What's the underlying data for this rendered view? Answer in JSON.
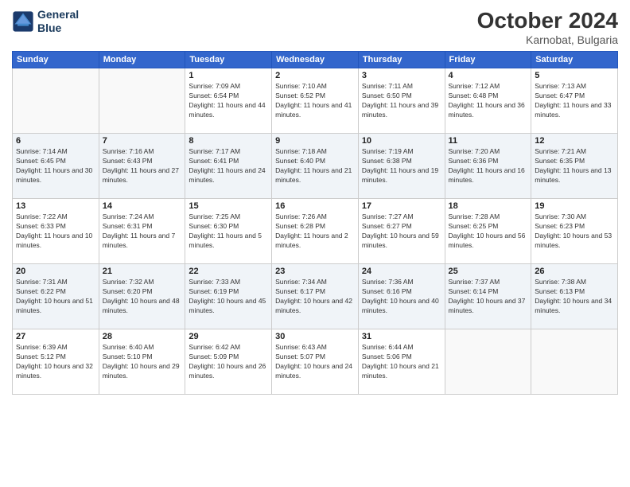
{
  "header": {
    "logo_line1": "General",
    "logo_line2": "Blue",
    "month": "October 2024",
    "location": "Karnobat, Bulgaria"
  },
  "weekdays": [
    "Sunday",
    "Monday",
    "Tuesday",
    "Wednesday",
    "Thursday",
    "Friday",
    "Saturday"
  ],
  "weeks": [
    [
      {
        "day": "",
        "info": ""
      },
      {
        "day": "",
        "info": ""
      },
      {
        "day": "1",
        "info": "Sunrise: 7:09 AM\nSunset: 6:54 PM\nDaylight: 11 hours and 44 minutes."
      },
      {
        "day": "2",
        "info": "Sunrise: 7:10 AM\nSunset: 6:52 PM\nDaylight: 11 hours and 41 minutes."
      },
      {
        "day": "3",
        "info": "Sunrise: 7:11 AM\nSunset: 6:50 PM\nDaylight: 11 hours and 39 minutes."
      },
      {
        "day": "4",
        "info": "Sunrise: 7:12 AM\nSunset: 6:48 PM\nDaylight: 11 hours and 36 minutes."
      },
      {
        "day": "5",
        "info": "Sunrise: 7:13 AM\nSunset: 6:47 PM\nDaylight: 11 hours and 33 minutes."
      }
    ],
    [
      {
        "day": "6",
        "info": "Sunrise: 7:14 AM\nSunset: 6:45 PM\nDaylight: 11 hours and 30 minutes."
      },
      {
        "day": "7",
        "info": "Sunrise: 7:16 AM\nSunset: 6:43 PM\nDaylight: 11 hours and 27 minutes."
      },
      {
        "day": "8",
        "info": "Sunrise: 7:17 AM\nSunset: 6:41 PM\nDaylight: 11 hours and 24 minutes."
      },
      {
        "day": "9",
        "info": "Sunrise: 7:18 AM\nSunset: 6:40 PM\nDaylight: 11 hours and 21 minutes."
      },
      {
        "day": "10",
        "info": "Sunrise: 7:19 AM\nSunset: 6:38 PM\nDaylight: 11 hours and 19 minutes."
      },
      {
        "day": "11",
        "info": "Sunrise: 7:20 AM\nSunset: 6:36 PM\nDaylight: 11 hours and 16 minutes."
      },
      {
        "day": "12",
        "info": "Sunrise: 7:21 AM\nSunset: 6:35 PM\nDaylight: 11 hours and 13 minutes."
      }
    ],
    [
      {
        "day": "13",
        "info": "Sunrise: 7:22 AM\nSunset: 6:33 PM\nDaylight: 11 hours and 10 minutes."
      },
      {
        "day": "14",
        "info": "Sunrise: 7:24 AM\nSunset: 6:31 PM\nDaylight: 11 hours and 7 minutes."
      },
      {
        "day": "15",
        "info": "Sunrise: 7:25 AM\nSunset: 6:30 PM\nDaylight: 11 hours and 5 minutes."
      },
      {
        "day": "16",
        "info": "Sunrise: 7:26 AM\nSunset: 6:28 PM\nDaylight: 11 hours and 2 minutes."
      },
      {
        "day": "17",
        "info": "Sunrise: 7:27 AM\nSunset: 6:27 PM\nDaylight: 10 hours and 59 minutes."
      },
      {
        "day": "18",
        "info": "Sunrise: 7:28 AM\nSunset: 6:25 PM\nDaylight: 10 hours and 56 minutes."
      },
      {
        "day": "19",
        "info": "Sunrise: 7:30 AM\nSunset: 6:23 PM\nDaylight: 10 hours and 53 minutes."
      }
    ],
    [
      {
        "day": "20",
        "info": "Sunrise: 7:31 AM\nSunset: 6:22 PM\nDaylight: 10 hours and 51 minutes."
      },
      {
        "day": "21",
        "info": "Sunrise: 7:32 AM\nSunset: 6:20 PM\nDaylight: 10 hours and 48 minutes."
      },
      {
        "day": "22",
        "info": "Sunrise: 7:33 AM\nSunset: 6:19 PM\nDaylight: 10 hours and 45 minutes."
      },
      {
        "day": "23",
        "info": "Sunrise: 7:34 AM\nSunset: 6:17 PM\nDaylight: 10 hours and 42 minutes."
      },
      {
        "day": "24",
        "info": "Sunrise: 7:36 AM\nSunset: 6:16 PM\nDaylight: 10 hours and 40 minutes."
      },
      {
        "day": "25",
        "info": "Sunrise: 7:37 AM\nSunset: 6:14 PM\nDaylight: 10 hours and 37 minutes."
      },
      {
        "day": "26",
        "info": "Sunrise: 7:38 AM\nSunset: 6:13 PM\nDaylight: 10 hours and 34 minutes."
      }
    ],
    [
      {
        "day": "27",
        "info": "Sunrise: 6:39 AM\nSunset: 5:12 PM\nDaylight: 10 hours and 32 minutes."
      },
      {
        "day": "28",
        "info": "Sunrise: 6:40 AM\nSunset: 5:10 PM\nDaylight: 10 hours and 29 minutes."
      },
      {
        "day": "29",
        "info": "Sunrise: 6:42 AM\nSunset: 5:09 PM\nDaylight: 10 hours and 26 minutes."
      },
      {
        "day": "30",
        "info": "Sunrise: 6:43 AM\nSunset: 5:07 PM\nDaylight: 10 hours and 24 minutes."
      },
      {
        "day": "31",
        "info": "Sunrise: 6:44 AM\nSunset: 5:06 PM\nDaylight: 10 hours and 21 minutes."
      },
      {
        "day": "",
        "info": ""
      },
      {
        "day": "",
        "info": ""
      }
    ]
  ]
}
